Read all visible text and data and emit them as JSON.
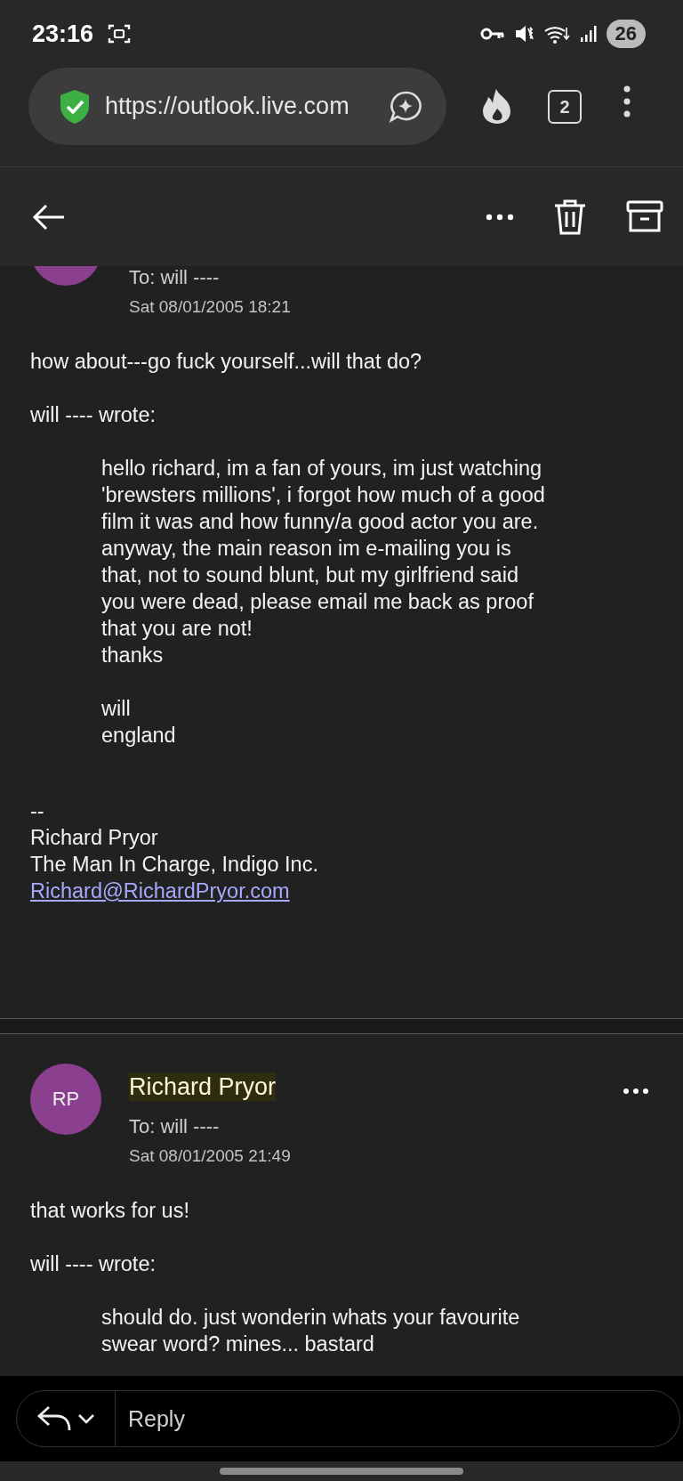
{
  "status_bar": {
    "time": "23:16",
    "battery": "26"
  },
  "browser": {
    "url": "https://outlook.live.com",
    "tab_count": "2"
  },
  "messages": [
    {
      "to": "To: will ----",
      "date": "Sat 08/01/2005 18:21",
      "body": [
        "how about---go fuck yourself...will that do?"
      ],
      "quote_header": "will ---- wrote:",
      "quote": [
        [
          "hello richard, im a fan of yours, im just watching",
          "'brewsters millions', i forgot how much of a good",
          "film it was and how funny/a good actor you are.",
          "anyway, the main reason im e-mailing you is",
          "that, not to sound blunt, but my girlfriend said",
          "you were dead, please email me back as proof",
          "that you are not!",
          "thanks"
        ],
        [
          "will",
          "england"
        ]
      ],
      "signature": [
        "--",
        "Richard Pryor",
        "The Man In Charge, Indigo Inc."
      ],
      "email": "Richard@RichardPryor.com"
    },
    {
      "initials": "RP",
      "sender": "Richard Pryor",
      "highlighted": true,
      "to": "To: will ----",
      "date": "Sat 08/01/2005 21:49",
      "body": [
        "that works for us!"
      ],
      "quote_header": "will ---- wrote:",
      "quote": [
        [
          "should do. just wonderin whats your favourite",
          "swear word? mines... bastard"
        ]
      ]
    }
  ],
  "reply": {
    "placeholder": "Reply"
  }
}
